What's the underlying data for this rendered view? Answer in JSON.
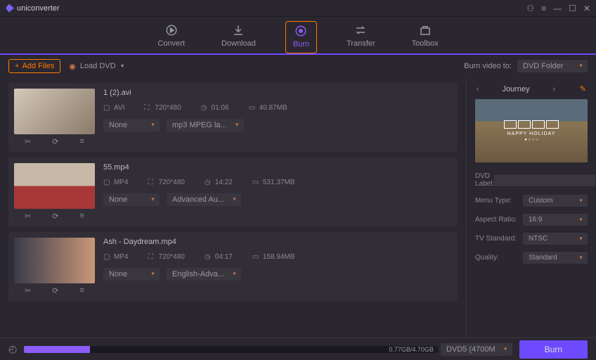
{
  "app": {
    "name": "uniconverter"
  },
  "tabs": [
    {
      "label": "Convert"
    },
    {
      "label": "Download"
    },
    {
      "label": "Burn"
    },
    {
      "label": "Transfer"
    },
    {
      "label": "Toolbox"
    }
  ],
  "toolbar": {
    "add_files": "Add Files",
    "load_dvd": "Load DVD",
    "burn_to_label": "Burn video to:",
    "burn_to_value": "DVD Folder"
  },
  "files": [
    {
      "name": "1 (2).avi",
      "format": "AVI",
      "resolution": "720*480",
      "duration": "01:06",
      "size": "40.87MB",
      "subtitle": "None",
      "audio": "mp3 MPEG la..."
    },
    {
      "name": "55.mp4",
      "format": "MP4",
      "resolution": "720*480",
      "duration": "14:22",
      "size": "531.37MB",
      "subtitle": "None",
      "audio": "Advanced Au..."
    },
    {
      "name": "Ash - Daydream.mp4",
      "format": "MP4",
      "resolution": "720*480",
      "duration": "04:17",
      "size": "158.94MB",
      "subtitle": "None",
      "audio": "English-Adva..."
    }
  ],
  "sidebar": {
    "title": "Journey",
    "preview_text": "HAPPY HOLIDAY",
    "labels": {
      "dvd_label": "DVD Label:",
      "menu_type": "Menu Type:",
      "aspect_ratio": "Aspect Ratio:",
      "tv_standard": "TV Standard:",
      "quality": "Quality:"
    },
    "values": {
      "dvd_label": "",
      "menu_type": "Custom",
      "aspect_ratio": "16:9",
      "tv_standard": "NTSC",
      "quality": "Standard"
    }
  },
  "footer": {
    "progress_text": "0.77GB/4.70GB",
    "dvd_type": "DVD5 (4700M",
    "burn": "Burn"
  }
}
